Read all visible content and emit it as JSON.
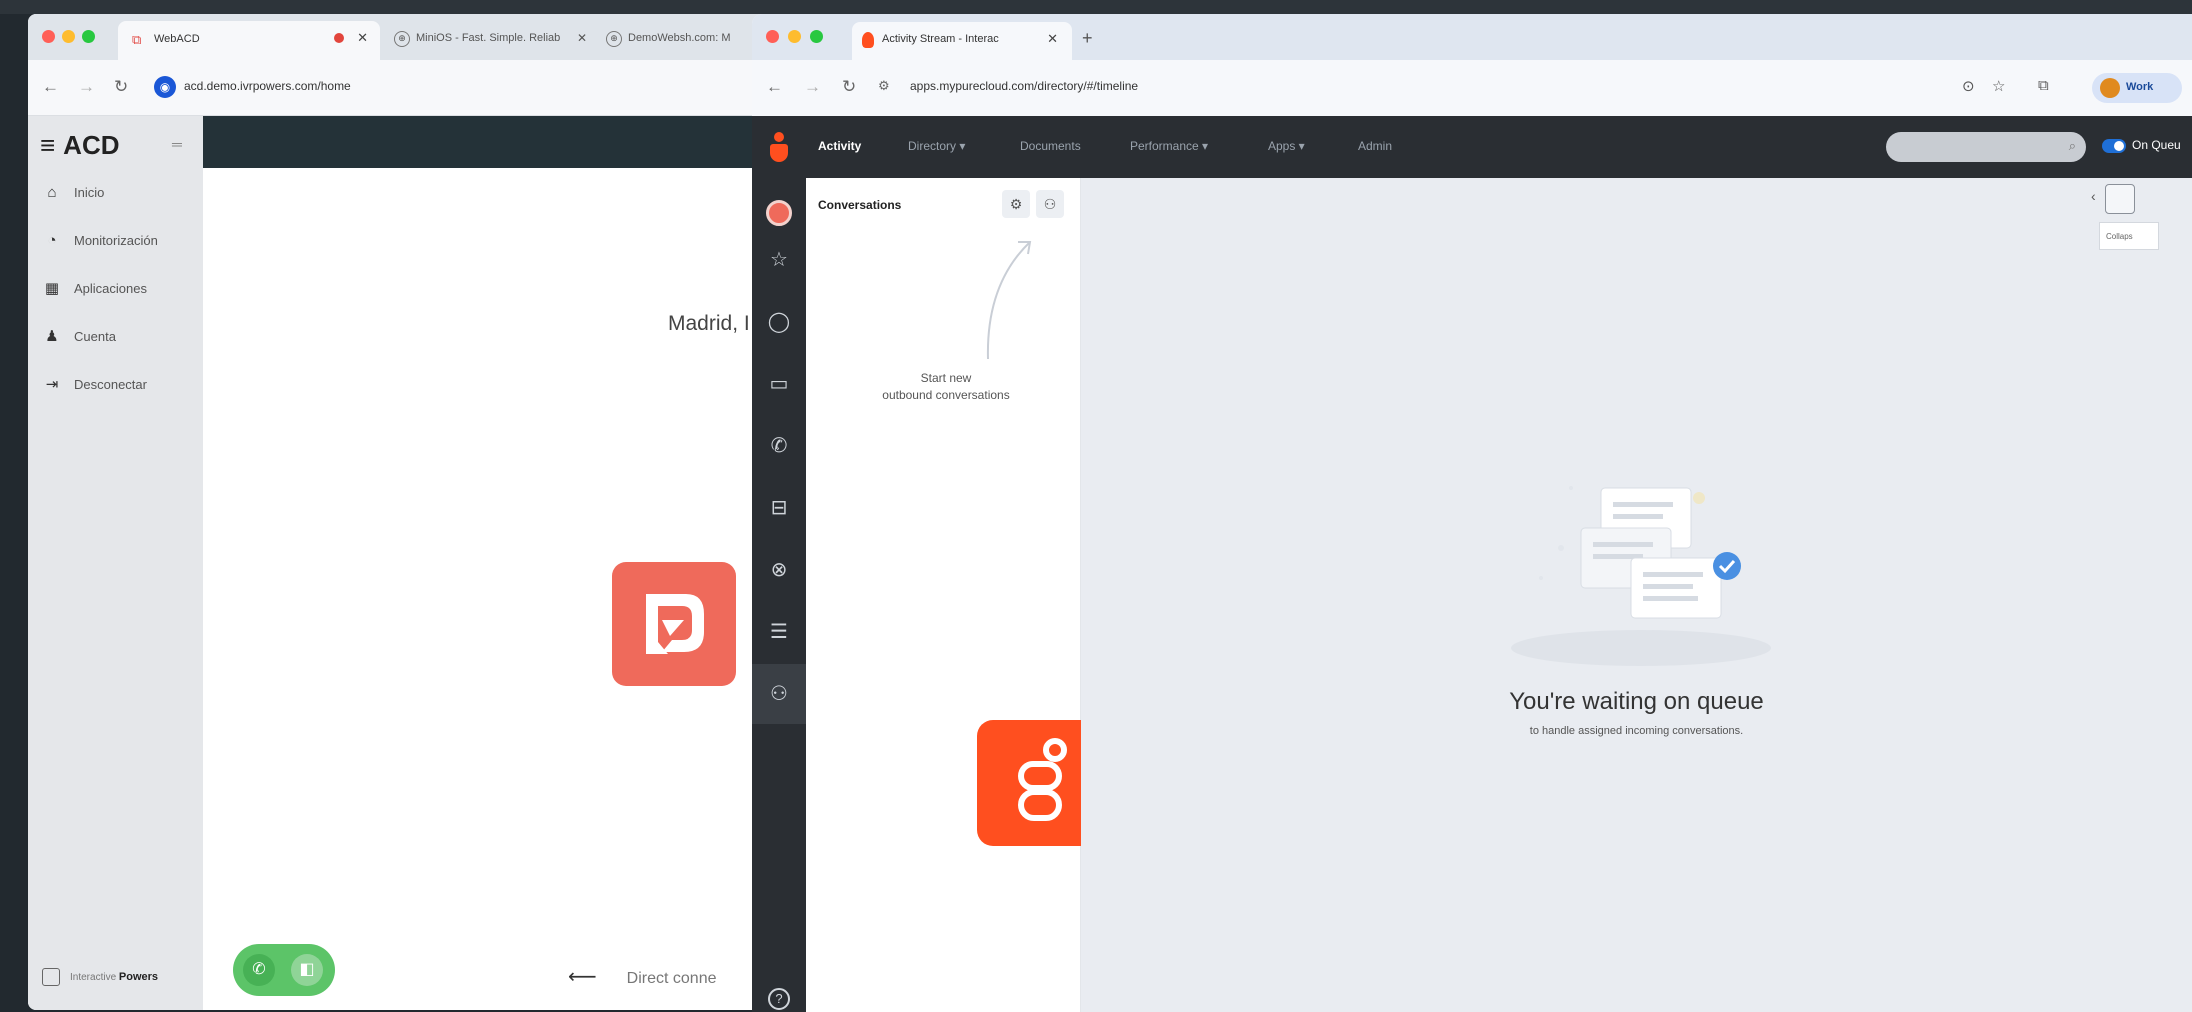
{
  "left_window": {
    "tab_active_title": "WebACD",
    "tab2_title": "MiniOS - Fast. Simple. Reliab",
    "tab3_title": "DemoWebsh.com: M",
    "url": "acd.demo.ivrpowers.com/home",
    "brand": "ACD",
    "sidebar_items": [
      {
        "label": "Inicio",
        "icon": "home-icon"
      },
      {
        "label": "Monitorización",
        "icon": "dashboard-icon"
      },
      {
        "label": "Aplicaciones",
        "icon": "apps-icon"
      },
      {
        "label": "Cuenta",
        "icon": "user-icon"
      },
      {
        "label": "Desconectar",
        "icon": "logout-icon"
      }
    ],
    "footer_prefix": "Interactive",
    "footer_brand": "Powers",
    "city": "Madrid, I",
    "direct_text": "Direct conne"
  },
  "right_window": {
    "tab_active_title": "Activity Stream - Interac",
    "url": "apps.mypurecloud.com/directory/#/timeline",
    "work_label": "Work",
    "nav_items": [
      {
        "label": "Activity",
        "active": true
      },
      {
        "label": "Directory ▾",
        "active": false
      },
      {
        "label": "Documents",
        "active": false
      },
      {
        "label": "Performance ▾",
        "active": false
      },
      {
        "label": "Apps ▾",
        "active": false
      },
      {
        "label": "Admin",
        "active": false
      }
    ],
    "on_queue_label": "On Queu",
    "conversations_title": "Conversations",
    "start_hint_line1": "Start new",
    "start_hint_line2": "outbound conversations",
    "tooltip_text": "Collaps",
    "waiting_title": "You're waiting on queue",
    "waiting_sub": "to handle assigned incoming conversations."
  },
  "colors": {
    "genesys_orange": "#ff4f1f",
    "acd_logo": "#ef6a5b",
    "nav_dark": "#2a2e33",
    "call_green": "#5cc468"
  }
}
